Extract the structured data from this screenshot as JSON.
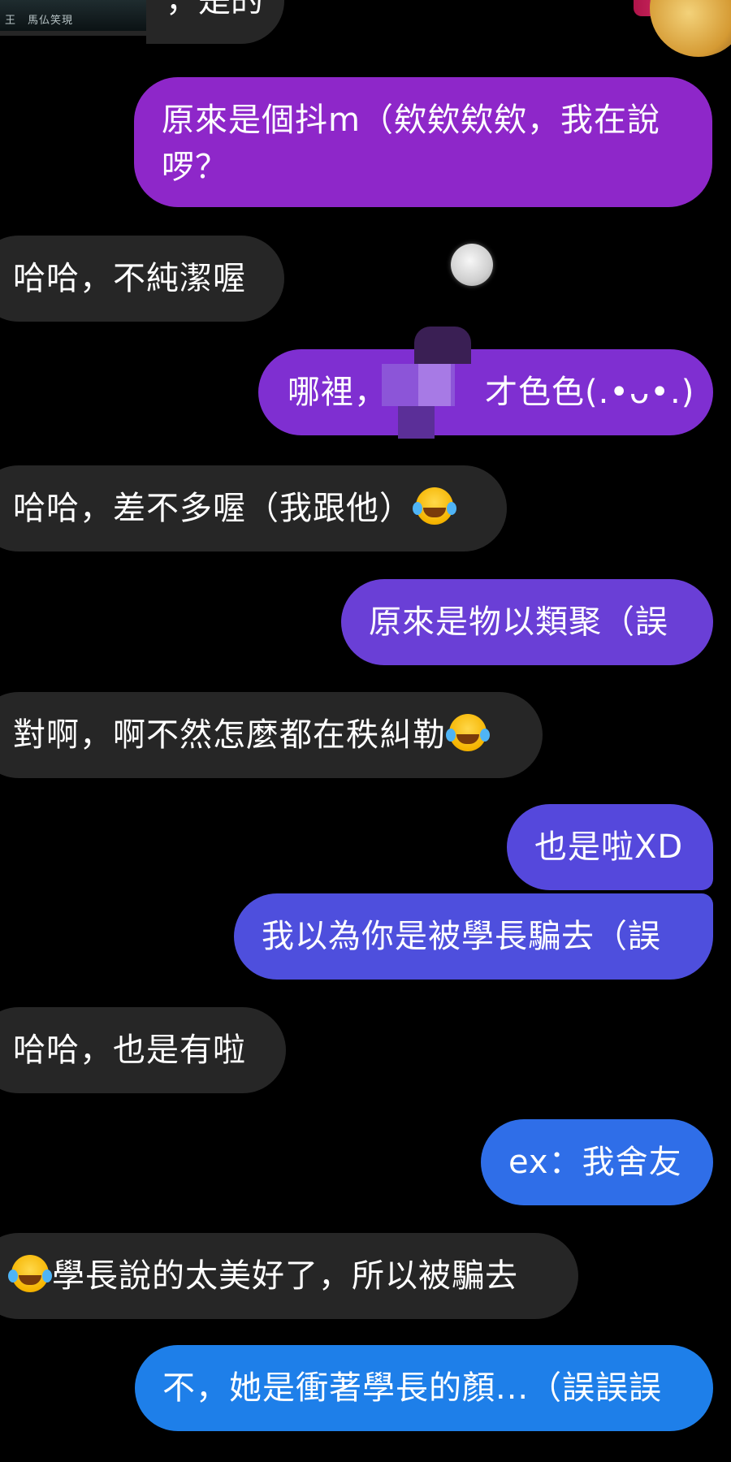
{
  "top": {
    "thumb_caption": "王　馬仏笑現",
    "partial_text": "，是的"
  },
  "messages": [
    {
      "id": "m1",
      "side": "sent",
      "text": "原來是個抖m（欸欸欸欸，我在說啰？"
    },
    {
      "id": "m2",
      "side": "received",
      "text": "哈哈，不純潔喔"
    },
    {
      "id": "m3",
      "side": "sent",
      "text_before": "哪裡，",
      "text_after": "才色色(.•ᴗ•.)"
    },
    {
      "id": "m4",
      "side": "received",
      "text": "哈哈，差不多喔（我跟他）"
    },
    {
      "id": "m5",
      "side": "sent",
      "text": "原來是物以類聚（誤"
    },
    {
      "id": "m6",
      "side": "received",
      "text": "對啊，啊不然怎麼都在秩糾勒"
    },
    {
      "id": "m7",
      "side": "sent",
      "text": "也是啦XD"
    },
    {
      "id": "m8",
      "side": "sent",
      "text": "我以為你是被學長騙去（誤"
    },
    {
      "id": "m9",
      "side": "received",
      "text": "哈哈，也是有啦"
    },
    {
      "id": "m10",
      "side": "sent",
      "text": "ex：我舍友"
    },
    {
      "id": "m11",
      "side": "received",
      "text": "學長說的太美好了，所以被騙去"
    },
    {
      "id": "m12",
      "side": "sent",
      "text": "不，她是衝著學長的顏...（誤誤誤"
    }
  ],
  "icons": {
    "emoji": "face-with-tears-of-joy-icon",
    "seen": "seen-avatar-icon"
  },
  "colors": {
    "background": "#000000",
    "received_bubble": "#262626",
    "sent_purple": "#8e27c9",
    "sent_violet": "#6a3fd6",
    "sent_indigo": "#4e4fdd",
    "sent_blue": "#2f6ee8",
    "sent_lightblue": "#1e7fe9"
  }
}
